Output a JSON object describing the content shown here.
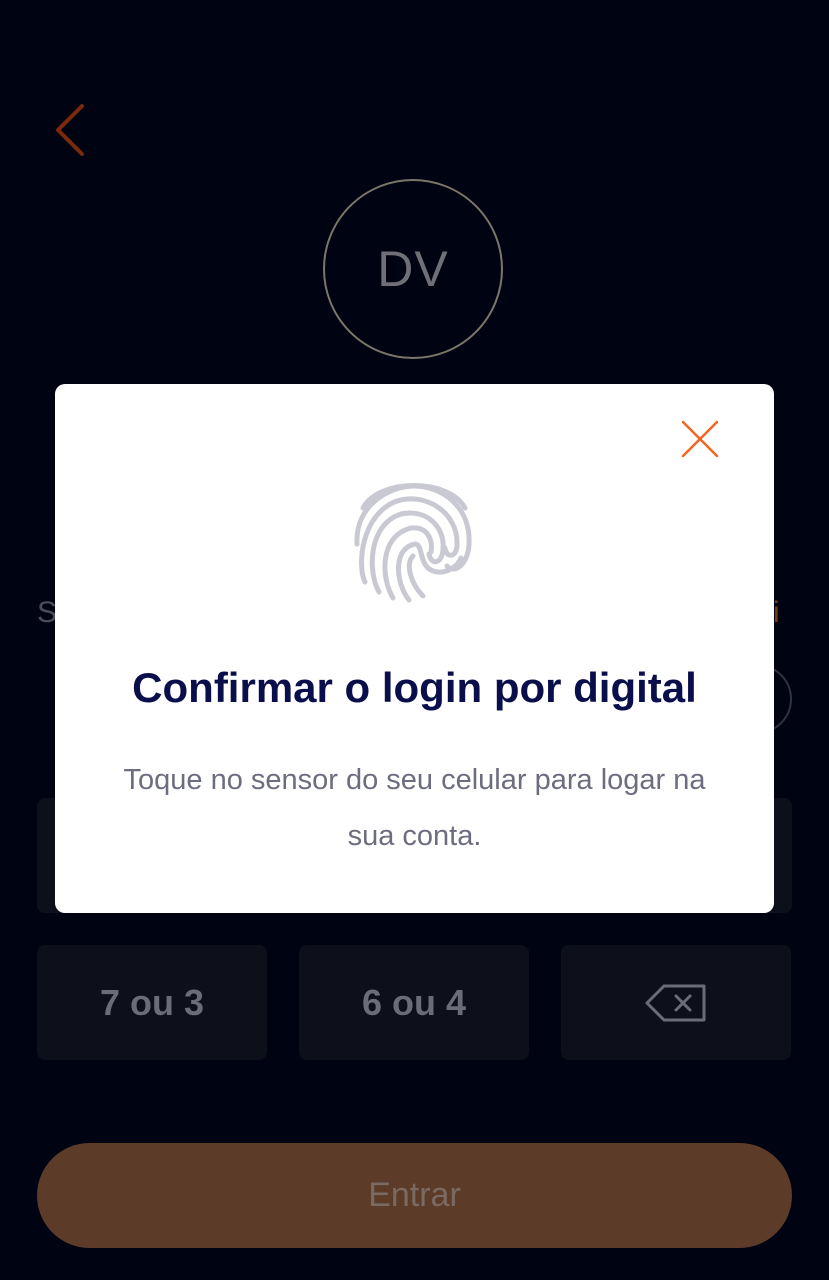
{
  "background": {
    "avatar_initials": "DV",
    "hidden_left_text": "S",
    "hidden_right_link": "ci",
    "keypad": [
      {
        "label": "7 ou 3"
      },
      {
        "label": "6 ou 4"
      }
    ],
    "backspace_icon": "backspace-icon",
    "submit_label": "Entrar"
  },
  "modal": {
    "title": "Confirmar o login por digital",
    "description": "Toque no sensor do seu celular para logar na sua conta.",
    "close_icon": "close-icon",
    "fingerprint_icon": "fingerprint-icon"
  },
  "colors": {
    "background": "#000312",
    "accent": "#f26522",
    "modal_title": "#0a0f4c",
    "modal_text": "#6d6d80",
    "submit_button": "#5d3b29"
  }
}
